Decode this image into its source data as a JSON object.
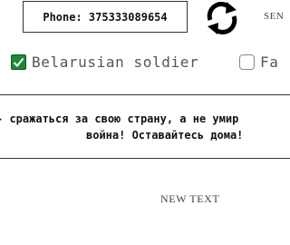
{
  "phone": {
    "label": "Phone: 375333089654"
  },
  "toolbar": {
    "refresh_icon": "refresh-arrows-icon",
    "send_label": "SEN"
  },
  "options": [
    {
      "label": "Belarusian soldier",
      "checked": true
    },
    {
      "label": "Fa",
      "checked": false
    }
  ],
  "message": {
    "line1": "- сражаться за свою страну, а не умир",
    "line2": "война! Оставайтесь дома!"
  },
  "footer": {
    "new_text": "NEW TEXT"
  },
  "colors": {
    "checkbox_checked": "#1a8a3a"
  }
}
